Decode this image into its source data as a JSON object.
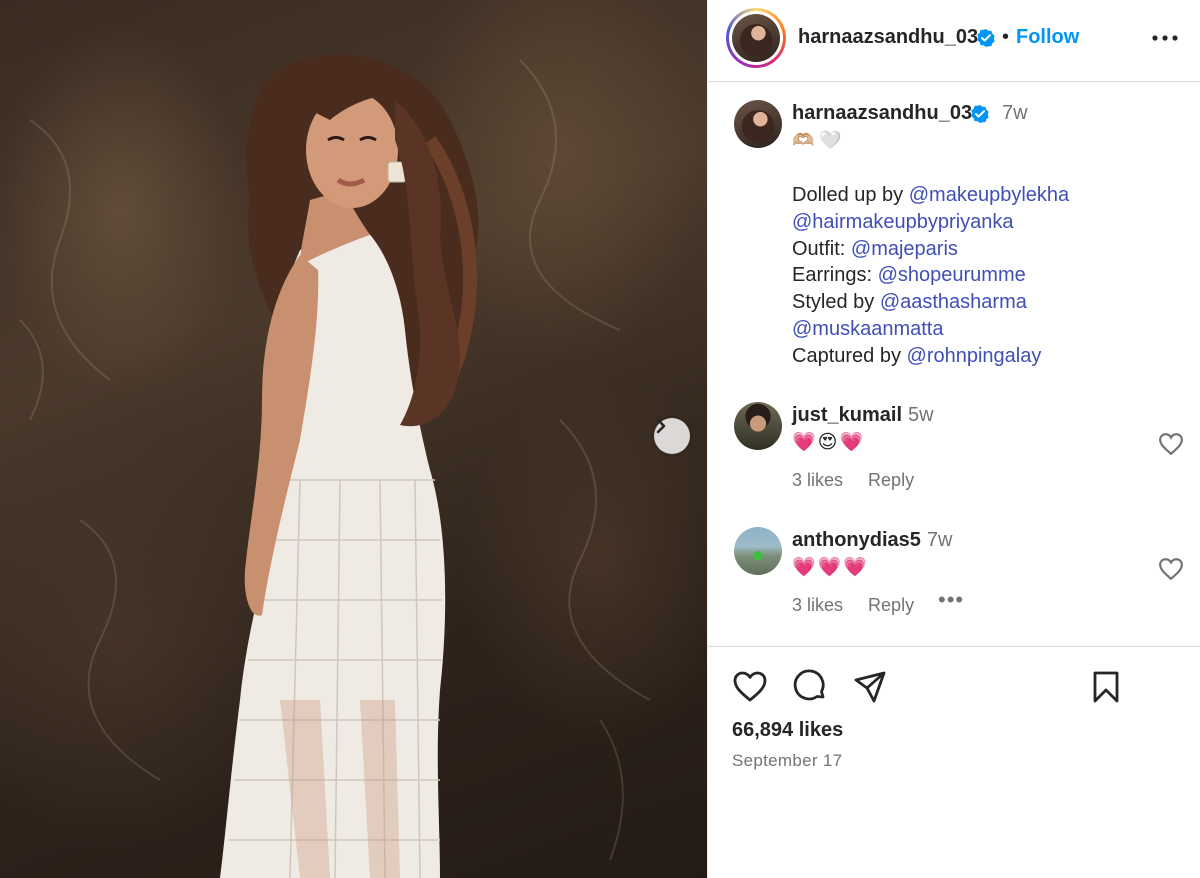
{
  "post": {
    "author": "harnaazsandhu_03",
    "follow_label": "Follow",
    "dot": "•",
    "caption": {
      "username": "harnaazsandhu_03",
      "time": "7w",
      "emoji": "🫶🏼 🤍",
      "lines": [
        {
          "prefix": "Dolled up by ",
          "mention": "@makeupbylekha"
        },
        {
          "prefix": "",
          "mention": "@hairmakeupbypriyanka"
        },
        {
          "prefix": "Outfit: ",
          "mention": "@majeparis"
        },
        {
          "prefix": "Earrings: ",
          "mention": "@shopeurumme"
        },
        {
          "prefix": "Styled by ",
          "mention": "@aasthasharma"
        },
        {
          "prefix": "",
          "mention": "@muskaanmatta"
        },
        {
          "prefix": "Captured by ",
          "mention": "@rohnpingalay"
        }
      ]
    },
    "comments": [
      {
        "username": "just_kumail",
        "time": "5w",
        "text": "💗😍💗",
        "likes": "3 likes",
        "reply": "Reply"
      },
      {
        "username": "anthonydias5",
        "time": "7w",
        "text": "💗💗💗",
        "likes": "3 likes",
        "reply": "Reply",
        "more": "•••"
      }
    ],
    "likes": "66,894 likes",
    "date": "September 17"
  },
  "colors": {
    "accent_blue": "#0095f6",
    "mention_blue": "#3f4fb6",
    "muted": "#737373",
    "text": "#262626"
  },
  "icons": {
    "verified": "verified-badge-icon",
    "more": "more-horizontal-icon",
    "next": "chevron-right-icon",
    "like": "heart-icon",
    "comment": "comment-icon",
    "share": "share-icon",
    "save": "bookmark-icon"
  }
}
